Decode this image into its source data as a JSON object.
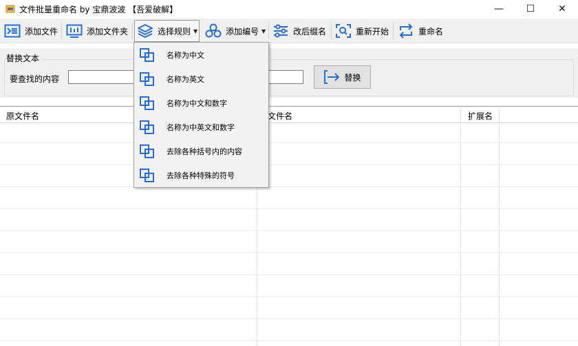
{
  "window": {
    "title": "文件批量重命名 by 宝鼎波波 【吾爱破解】",
    "minimize": "—",
    "maximize": "☐",
    "close": "✕"
  },
  "toolbar": {
    "add_file": "添加文件",
    "add_folder": "添加文件夹",
    "select_rule": "选择规则",
    "add_number": "添加编号",
    "change_ext": "改后缀名",
    "restart": "重新开始",
    "rename": "重命名",
    "dropdown_arrow": "▼"
  },
  "replace_group": {
    "title": "替换文本",
    "find_label": "要查找的内容",
    "find_value": "",
    "replace_value": "",
    "replace_button": "替换"
  },
  "grid": {
    "columns": [
      "原文件名",
      "新文件名",
      "扩展名"
    ]
  },
  "rule_menu": {
    "items": [
      "名称为中文",
      "名称为英文",
      "名称为中文和数字",
      "名称为中英文和数字",
      "去除各种括号内的内容",
      "去除各种特殊的符号"
    ]
  },
  "colors": {
    "icon_blue": "#1e6fd9",
    "toolbar_bg": "#f0f0f0",
    "menu_bg": "#f2f2f2"
  }
}
